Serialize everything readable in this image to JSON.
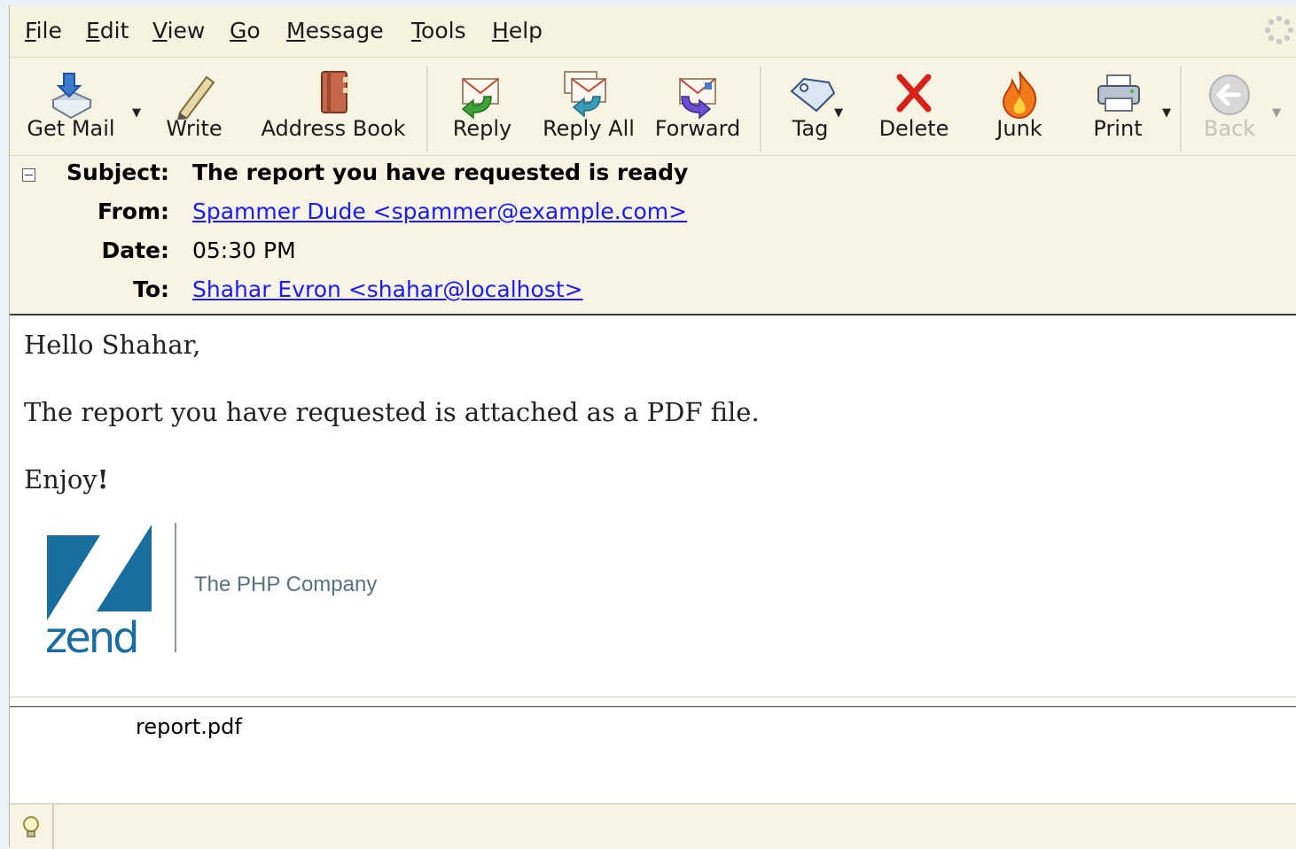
{
  "menu": [
    {
      "key": "F",
      "rest": "ile"
    },
    {
      "key": "E",
      "rest": "dit"
    },
    {
      "key": "V",
      "rest": "iew"
    },
    {
      "key": "G",
      "rest": "o"
    },
    {
      "key": "M",
      "rest": "essage"
    },
    {
      "key": "T",
      "rest": "ools"
    },
    {
      "key": "H",
      "rest": "elp"
    }
  ],
  "toolbar": {
    "get_mail": "Get Mail",
    "write": "Write",
    "address_book": "Address Book",
    "reply": "Reply",
    "reply_all": "Reply All",
    "forward": "Forward",
    "tag": "Tag",
    "delete": "Delete",
    "junk": "Junk",
    "print": "Print",
    "back": "Back"
  },
  "header": {
    "subject_label": "Subject:",
    "subject": "The report you have requested is ready",
    "from_label": "From:",
    "from": "Spammer Dude <spammer@example.com>",
    "date_label": "Date:",
    "date": "05:30 PM",
    "to_label": "To:",
    "to": "Shahar Evron <shahar@localhost>"
  },
  "body": {
    "greeting": "Hello Shahar,",
    "line1": "The report you have requested is attached as a PDF file.",
    "enjoy_text": "Enjoy",
    "enjoy_bang": "!"
  },
  "signature": {
    "logo_word": "zend",
    "tagline": "The PHP Company",
    "brand_color": "#1a6e9f"
  },
  "attachment": {
    "name": "report.pdf"
  }
}
